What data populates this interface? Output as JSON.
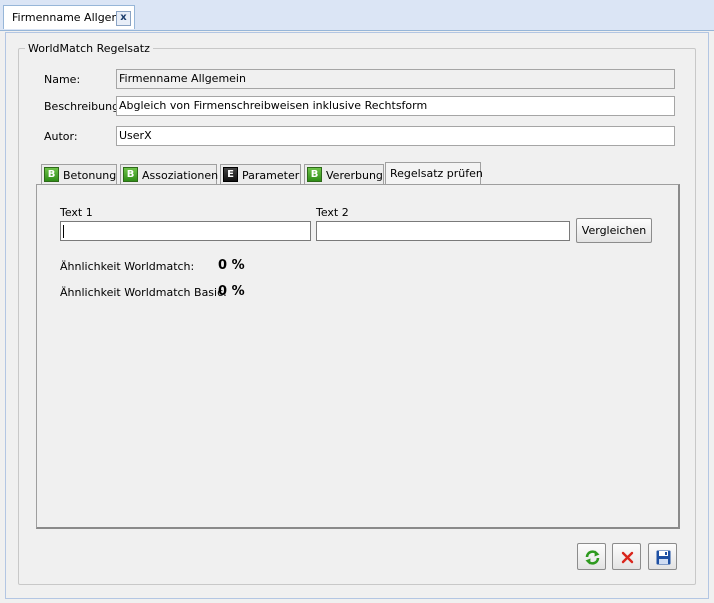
{
  "document_tab": {
    "title": "Firmenname Allgemein",
    "close_label": "x"
  },
  "group": {
    "legend": "WorldMatch Regelsatz"
  },
  "fields": {
    "name": {
      "label": "Name:",
      "value": "Firmenname Allgemein"
    },
    "beschreibung": {
      "label": "Beschreibung:",
      "value": "Abgleich von Firmenschreibweisen inklusive Rechtsform"
    },
    "autor": {
      "label": "Autor:",
      "value": "UserX"
    }
  },
  "tabs": [
    {
      "badge": "B",
      "label": "Betonung"
    },
    {
      "badge": "B",
      "label": "Assoziationen"
    },
    {
      "badge": "E",
      "label": "Parameter"
    },
    {
      "badge": "B",
      "label": "Vererbung"
    },
    {
      "badge": "",
      "label": "Regelsatz prüfen",
      "active": true
    }
  ],
  "check_panel": {
    "text1_label": "Text 1",
    "text1_value": "",
    "text2_label": "Text 2",
    "text2_value": "",
    "compare_button": "Vergleichen",
    "similarity_worldmatch_label": "Ähnlichkeit Worldmatch:",
    "similarity_worldmatch_value": "0 %",
    "similarity_basic_label": "Ähnlichkeit Worldmatch Basic:",
    "similarity_basic_value": "0 %"
  },
  "footer_buttons": [
    {
      "icon": "refresh-icon",
      "color": "#2e9a1f"
    },
    {
      "icon": "close-icon",
      "color": "#d9261c"
    },
    {
      "icon": "save-icon",
      "color": "#1d4fa3"
    }
  ]
}
